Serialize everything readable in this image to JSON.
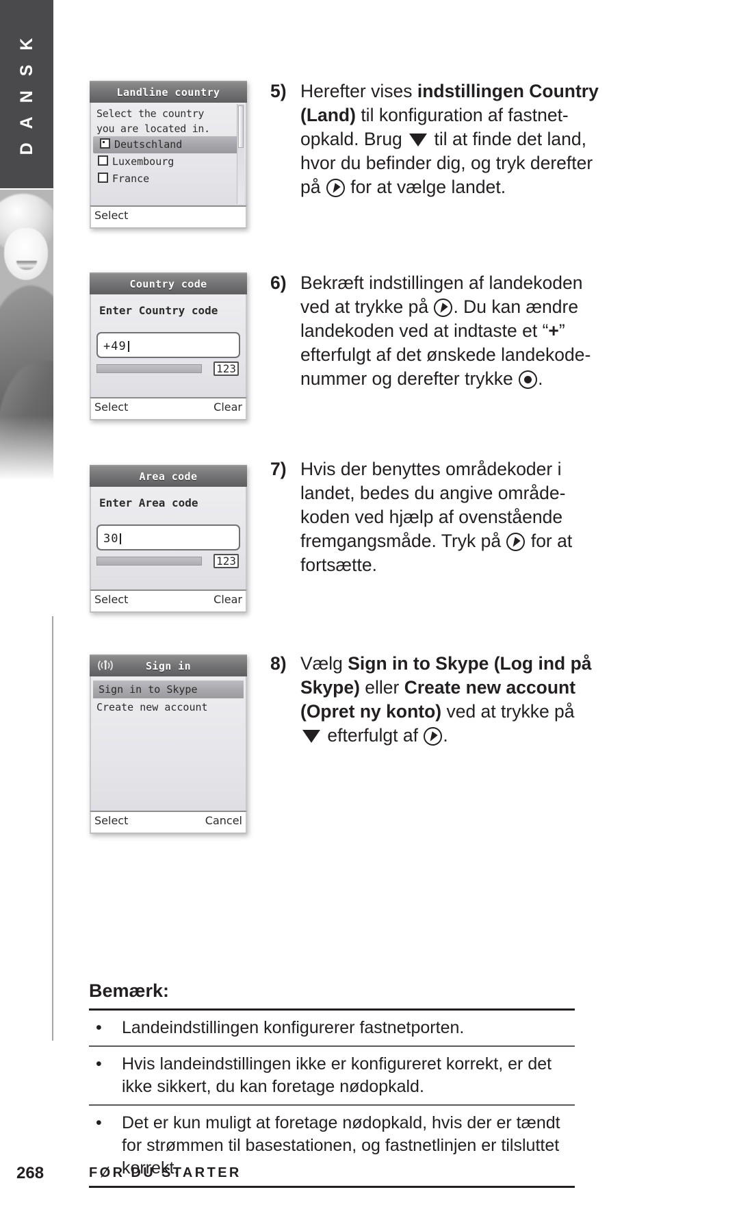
{
  "language_tab": {
    "label": "D A N S K"
  },
  "footer": {
    "page_number": "268",
    "section": "FØR DU STARTER"
  },
  "screens": [
    {
      "id": "landline-country",
      "title": "Landline country",
      "signal_icon": "",
      "prompt_lines": [
        "Select the country",
        "you are located in."
      ],
      "options": [
        {
          "label": "Deutschland",
          "selected": true
        },
        {
          "label": "Luxembourg",
          "selected": false
        },
        {
          "label": "France",
          "selected": false
        }
      ],
      "softkey_left": "Select",
      "softkey_right": ""
    },
    {
      "id": "country-code",
      "title": "Country code",
      "prompt": "Enter Country code",
      "input_value": "+49",
      "mode_badge": "123",
      "softkey_left": "Select",
      "softkey_right": "Clear"
    },
    {
      "id": "area-code",
      "title": "Area code",
      "prompt": "Enter Area code",
      "input_value": "30",
      "mode_badge": "123",
      "softkey_left": "Select",
      "softkey_right": "Clear"
    },
    {
      "id": "sign-in",
      "title": "Sign in",
      "signal_icon": "signal-antenna-icon",
      "items": [
        {
          "label": "Sign in to Skype",
          "selected": true
        },
        {
          "label": "Create new account",
          "selected": false
        }
      ],
      "softkey_left": "Select",
      "softkey_right": "Cancel"
    }
  ],
  "steps": {
    "step5": {
      "number": "5)",
      "t1": "Herefter vises ",
      "b1": "indstillingen Country",
      "b2": "(Land)",
      "t2": " til konfiguration af fastnet-",
      "t3": "opkald. Brug ",
      "t4": " til at finde det land,",
      "t5": "hvor du befinder dig, og tryk derefter",
      "t6": "på ",
      "t7": " for at vælge landet."
    },
    "step6": {
      "number": "6)",
      "t1": "Bekræft indstillingen af landekoden",
      "t2": "ved at trykke på ",
      "t3": ". Du kan ændre",
      "t4": "landekoden ved at indtaste et “",
      "b1": "+",
      "t5": "”",
      "t6": "efterfulgt af det ønskede landekode-",
      "t7": "nummer og derefter trykke ",
      "t8": "."
    },
    "step7": {
      "number": "7)",
      "t1": "Hvis der benyttes områdekoder i",
      "t2": "landet, bedes du angive område-",
      "t3": "koden ved hjælp af ovenstående",
      "t4": "fremgangsmåde. Tryk på ",
      "t5": " for at",
      "t6": "fortsætte."
    },
    "step8": {
      "number": "8)",
      "t1": "Vælg ",
      "b1": "Sign in to Skype (Log ind på",
      "b2": "Skype)",
      "t2": " eller ",
      "b3": "Create new account",
      "b4": "(Opret ny konto)",
      "t3": " ved at trykke på",
      "t4": " efterfulgt af ",
      "t5": "."
    }
  },
  "notes": {
    "title": "Bemærk:",
    "items": [
      "Landeindstillingen konfigurerer fastnetporten.",
      "Hvis landeindstillingen ikke er konfigureret korrekt, er det ikke sikkert, du kan foretage nødopkald.",
      "Det er kun muligt at foretage nødopkald, hvis der er tændt for strømmen til basestationen, og fastnetlinjen er tilsluttet korrekt."
    ]
  }
}
